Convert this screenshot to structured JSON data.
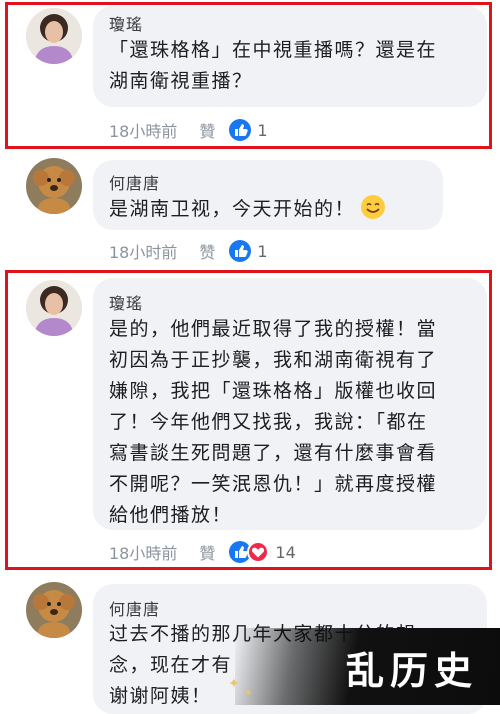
{
  "comments": [
    {
      "author": "瓊瑤",
      "lines": [
        "「還珠格格」在中視重播嗎？還是在",
        "湖南衛視重播？"
      ],
      "time": "18小時前",
      "like_label": "贊",
      "reaction_count": "1",
      "reactions": [
        "like-icon"
      ]
    },
    {
      "author": "何唐唐",
      "lines": [
        "是湖南卫视，今天开始的！"
      ],
      "time": "18小时前",
      "like_label": "赞",
      "reaction_count": "1",
      "reactions": [
        "like-icon"
      ],
      "emoji": "smiley-emoji-icon"
    },
    {
      "author": "瓊瑤",
      "lines": [
        "是的，他們最近取得了我的授權！當",
        "初因為于正抄襲，我和湖南衛視有了",
        "嫌隙，我把「還珠格格」版權也收回",
        "了！今年他們又找我，我說：「都在",
        "寫書談生死問題了，還有什麼事會看",
        "不開呢？一笑泯恩仇！」就再度授權",
        "給他們播放！"
      ],
      "time": "18小時前",
      "like_label": "贊",
      "reaction_count": "14",
      "reactions": [
        "like-icon",
        "love-icon"
      ]
    },
    {
      "author": "何唐唐",
      "lines": [
        "过去不播的那几年大家都十分的想",
        "念，现在才有",
        "谢谢阿姨！"
      ]
    }
  ],
  "watermark": {
    "text": "乱历史"
  },
  "colors": {
    "highlight": "#e0121b",
    "like": "#1877f2",
    "love": "#f02849",
    "bubble": "#f0f2f5"
  }
}
